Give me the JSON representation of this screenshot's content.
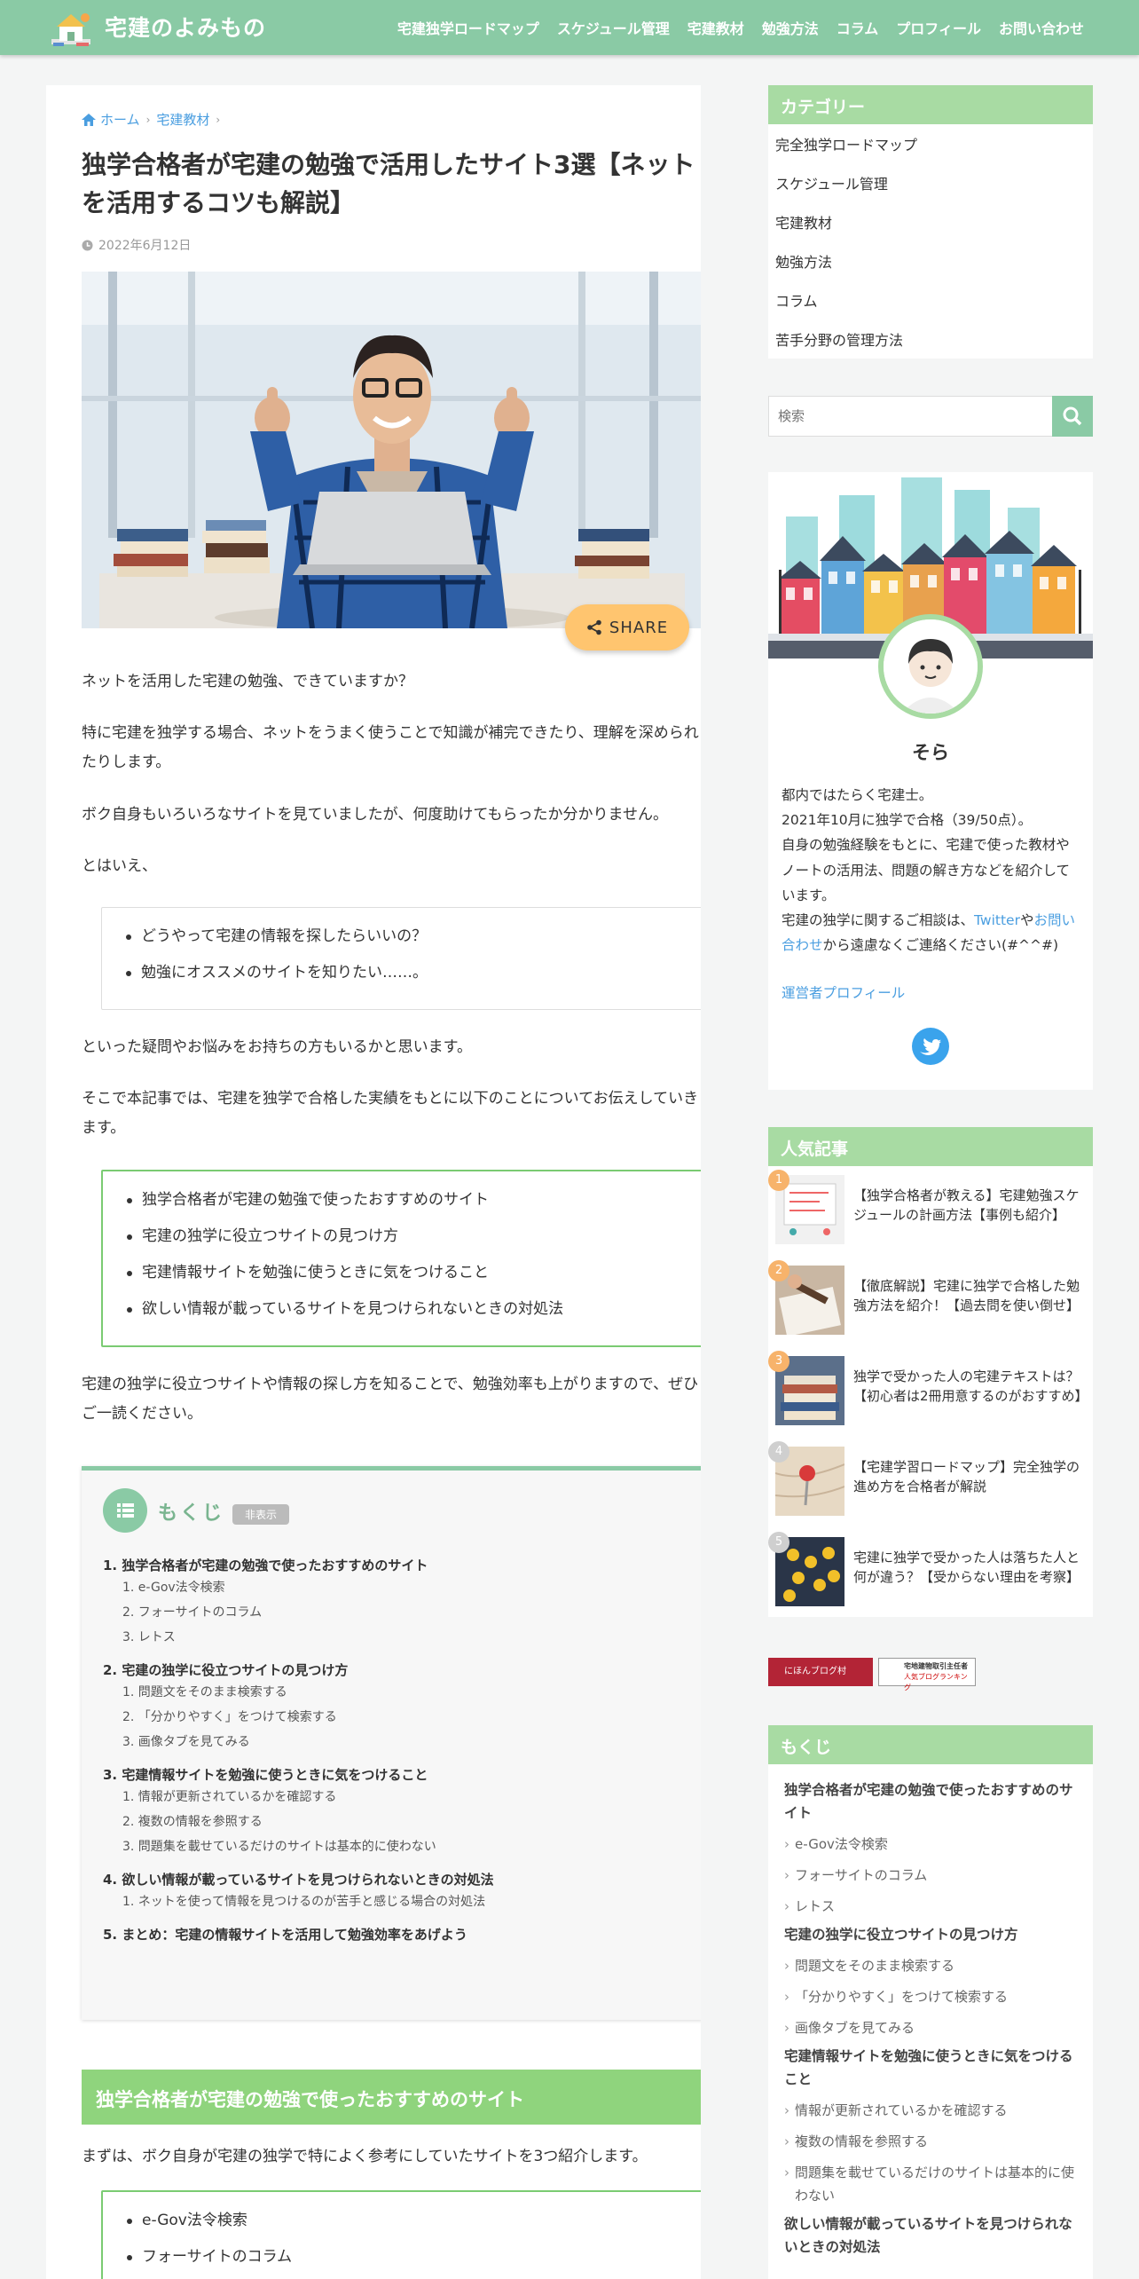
{
  "site": {
    "title": "宅建のよみもの"
  },
  "nav": [
    "宅建独学ロードマップ",
    "スケジュール管理",
    "宅建教材",
    "勉強方法",
    "コラム",
    "プロフィール",
    "お問い合わせ"
  ],
  "breadcrumb": {
    "home": "ホーム",
    "category": "宅建教材"
  },
  "article": {
    "title": "独学合格者が宅建の勉強で活用したサイト3選【ネットを活用するコツも解説】",
    "date": "2022年6月12日",
    "share": "SHARE",
    "p1": "ネットを活用した宅建の勉強、できていますか？",
    "p2": "特に宅建を独学する場合、ネットをうまく使うことで知識が補完できたり、理解を深められたりします。",
    "p3": "ボク自身もいろいろなサイトを見ていましたが、何度助けてもらったか分かりません。",
    "p4": "とはいえ、",
    "box1": [
      "どうやって宅建の情報を探したらいいの？",
      "勉強にオススメのサイトを知りたい……。"
    ],
    "p5": "といった疑問やお悩みをお持ちの方もいるかと思います。",
    "p6": "そこで本記事では、宅建を独学で合格した実績をもとに以下のことについてお伝えしていきます。",
    "box2": [
      "独学合格者が宅建の勉強で使ったおすすめのサイト",
      "宅建の独学に役立つサイトの見つけ方",
      "宅建情報サイトを勉強に使うときに気をつけること",
      "欲しい情報が載っているサイトを見つけられないときの対処法"
    ],
    "p7": "宅建の独学に役立つサイトや情報の探し方を知ることで、勉強効率も上がりますので、ぜひご一読ください。",
    "h2": "独学合格者が宅建の勉強で使ったおすすめのサイト",
    "p8": "まずは、ボク自身が宅建の独学で特によく参考にしていたサイトを3つ紹介します。",
    "box3": [
      "e-Gov法令検索",
      "フォーサイトのコラム"
    ]
  },
  "toc": {
    "title": "もくじ",
    "hide": "非表示",
    "sections": [
      {
        "label": "1. 独学合格者が宅建の勉強で使ったおすすめのサイト",
        "items": [
          "1. e-Gov法令検索",
          "2. フォーサイトのコラム",
          "3. レトス"
        ]
      },
      {
        "label": "2. 宅建の独学に役立つサイトの見つけ方",
        "items": [
          "1. 問題文をそのまま検索する",
          "2. 「分かりやすく」をつけて検索する",
          "3. 画像タブを見てみる"
        ]
      },
      {
        "label": "3. 宅建情報サイトを勉強に使うときに気をつけること",
        "items": [
          "1. 情報が更新されているかを確認する",
          "2. 複数の情報を参照する",
          "3. 問題集を載せているだけのサイトは基本的に使わない"
        ]
      },
      {
        "label": "4. 欲しい情報が載っているサイトを見つけられないときの対処法",
        "items": [
          "1. ネットを使って情報を見つけるのが苦手と感じる場合の対処法"
        ]
      },
      {
        "label": "5. まとめ：宅建の情報サイトを活用して勉強効率をあげよう",
        "items": []
      }
    ]
  },
  "sidebar": {
    "categories": {
      "title": "カテゴリー",
      "items": [
        "完全独学ロードマップ",
        "スケジュール管理",
        "宅建教材",
        "勉強方法",
        "コラム",
        "苦手分野の管理方法"
      ]
    },
    "search": {
      "placeholder": "検索"
    },
    "profile": {
      "name": "そら",
      "line1": "都内ではたらく宅建士。",
      "line2": "2021年10月に独学で合格（39/50点）。",
      "line3": "自身の勉強経験をもとに、宅建で使った教材やノートの活用法、問題の解き方などを紹介しています。",
      "line4a": "宅建の独学に関するご相談は、",
      "twitter": "Twitter",
      "line4b": "や",
      "contact": "お問い合わせ",
      "line4c": "から遠慮なくご連絡ください(#^^#)",
      "link": "運営者プロフィール"
    },
    "popular": {
      "title": "人気記事",
      "items": [
        {
          "rank": "1",
          "text": "【独学合格者が教える】宅建勉強スケジュールの計画方法【事例も紹介】",
          "color": "#f7b36b"
        },
        {
          "rank": "2",
          "text": "【徹底解説】宅建に独学で合格した勉強方法を紹介！【過去問を使い倒せ】",
          "color": "#f7b36b"
        },
        {
          "rank": "3",
          "text": "独学で受かった人の宅建テキストは？【初心者は2冊用意するのがおすすめ】",
          "color": "#f7b36b"
        },
        {
          "rank": "4",
          "text": "【宅建学習ロードマップ】完全独学の進め方を合格者が解説",
          "color": "#cfcfcf"
        },
        {
          "rank": "5",
          "text": "宅建に独学で受かった人は落ちた人と何が違う？【受からない理由を考察】",
          "color": "#cfcfcf"
        }
      ]
    },
    "banners": {
      "b1": "にほんブログ村",
      "b2a": "宅地建物取引主任者",
      "b2b": "人気ブログランキング"
    },
    "toc": {
      "title": "もくじ",
      "items": [
        {
          "level": 1,
          "text": "独学合格者が宅建の勉強で使ったおすすめのサイト"
        },
        {
          "level": 2,
          "text": "e-Gov法令検索"
        },
        {
          "level": 2,
          "text": "フォーサイトのコラム"
        },
        {
          "level": 2,
          "text": "レトス"
        },
        {
          "level": 1,
          "text": "宅建の独学に役立つサイトの見つけ方"
        },
        {
          "level": 2,
          "text": "問題文をそのまま検索する"
        },
        {
          "level": 2,
          "text": "「分かりやすく」をつけて検索する"
        },
        {
          "level": 2,
          "text": "画像タブを見てみる"
        },
        {
          "level": 1,
          "text": "宅建情報サイトを勉強に使うときに気をつけること"
        },
        {
          "level": 2,
          "text": "情報が更新されているかを確認する"
        },
        {
          "level": 2,
          "text": "複数の情報を参照する"
        },
        {
          "level": 2,
          "text": "問題集を載せているだけのサイトは基本的に使わない"
        },
        {
          "level": 1,
          "text": "欲しい情報が載っているサイトを見つけられないときの対処法"
        }
      ]
    }
  }
}
